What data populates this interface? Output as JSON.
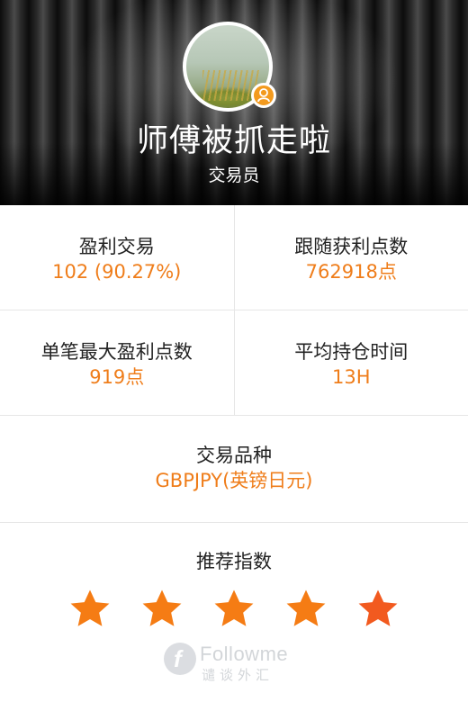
{
  "profile": {
    "name": "师傅被抓走啦",
    "role": "交易员"
  },
  "stats": {
    "profit_trades": {
      "label": "盈利交易",
      "value": "102 (90.27%)"
    },
    "follow_profit_points": {
      "label": "跟随获利点数",
      "value": "762918点"
    },
    "max_single_profit": {
      "label": "单笔最大盈利点数",
      "value": "919点"
    },
    "avg_hold_time": {
      "label": "平均持仓时间",
      "value": "13H"
    },
    "instrument": {
      "label": "交易品种",
      "value": "GBPJPY(英镑日元)"
    }
  },
  "rating": {
    "label": "推荐指数",
    "stars": 5,
    "star_colors": [
      "#f57c14",
      "#f57c14",
      "#f57c14",
      "#f57c14",
      "#f25a1f"
    ]
  },
  "watermark": {
    "logo_letter": "f",
    "brand": "Followme",
    "sub": "谴谈外汇"
  },
  "colors": {
    "accent": "#ef7d1a",
    "badge": "#f39a1e",
    "divider": "#e6e6e6"
  }
}
